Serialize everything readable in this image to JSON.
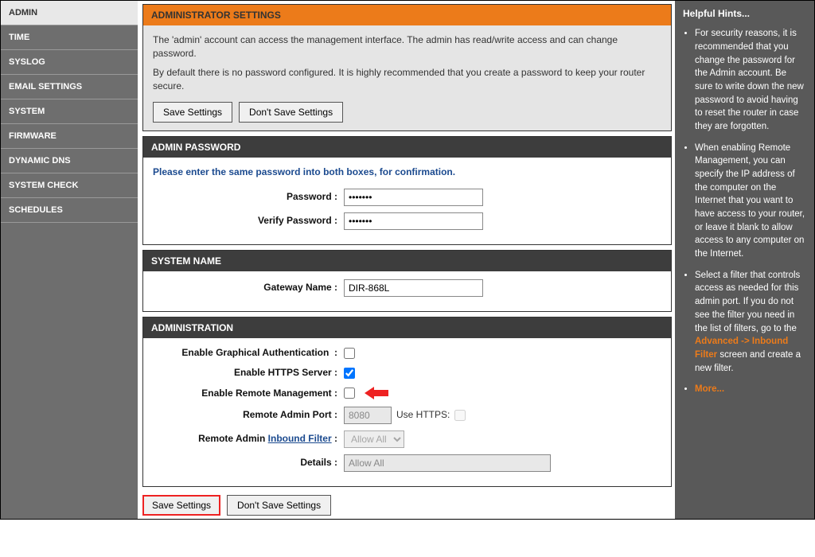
{
  "sidebar": {
    "items": [
      {
        "label": "ADMIN",
        "active": true
      },
      {
        "label": "TIME"
      },
      {
        "label": "SYSLOG"
      },
      {
        "label": "EMAIL SETTINGS"
      },
      {
        "label": "SYSTEM"
      },
      {
        "label": "FIRMWARE"
      },
      {
        "label": "DYNAMIC DNS"
      },
      {
        "label": "SYSTEM CHECK"
      },
      {
        "label": "SCHEDULES"
      }
    ]
  },
  "admin_settings": {
    "title": "ADMINISTRATOR SETTINGS",
    "desc1": "The 'admin' account can access the management interface. The admin has read/write access and can change password.",
    "desc2": "By default there is no password configured. It is highly recommended that you create a password to keep your router secure.",
    "save": "Save Settings",
    "dont_save": "Don't Save Settings"
  },
  "admin_password": {
    "title": "ADMIN PASSWORD",
    "info": "Please enter the same password into both boxes, for confirmation.",
    "password_label": "Password  :",
    "verify_label": "Verify Password  :",
    "password_value": "•••••••",
    "verify_value": "•••••••"
  },
  "system_name": {
    "title": "SYSTEM NAME",
    "gateway_label": "Gateway Name  :",
    "gateway_value": "DIR-868L"
  },
  "administration": {
    "title": "ADMINISTRATION",
    "graphical_label": "Enable Graphical Authentication",
    "graphical_colon": ":",
    "https_label": "Enable HTTPS Server  :",
    "remote_mgmt_label": "Enable Remote Management  :",
    "remote_port_label": "Remote Admin Port  :",
    "remote_port_value": "8080",
    "use_https_label": "Use HTTPS:",
    "inbound_label_pre": "Remote Admin ",
    "inbound_link": "Inbound Filter",
    "inbound_colon": "  :",
    "inbound_value": "Allow All",
    "details_label": "Details  :",
    "details_value": "Allow All",
    "graphical_checked": false,
    "https_checked": true,
    "remote_mgmt_checked": false,
    "use_https_checked": false
  },
  "bottom": {
    "save": "Save Settings",
    "dont_save": "Don't Save Settings"
  },
  "hints": {
    "title": "Helpful Hints...",
    "item1": "For security reasons, it is recommended that you change the password for the Admin account. Be sure to write down the new password to avoid having to reset the router in case they are forgotten.",
    "item2": "When enabling Remote Management, you can specify the IP address of the computer on the Internet that you want to have access to your router, or leave it blank to allow access to any computer on the Internet.",
    "item3_pre": "Select a filter that controls access as needed for this admin port. If you do not see the filter you need in the list of filters, go to the ",
    "item3_link": "Advanced -> Inbound Filter",
    "item3_post": " screen and create a new filter.",
    "more": "More..."
  }
}
